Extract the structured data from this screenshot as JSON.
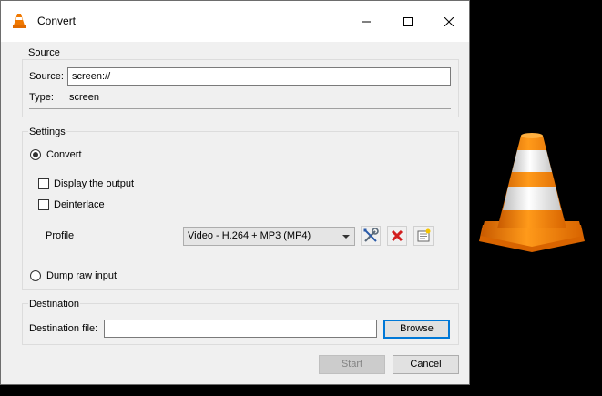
{
  "window": {
    "title": "Convert",
    "controls": {
      "minimize": "minimize",
      "maximize": "maximize",
      "close": "close"
    }
  },
  "source": {
    "group_title": "Source",
    "source_label": "Source:",
    "source_value": "screen://",
    "type_label": "Type:",
    "type_value": "screen"
  },
  "settings": {
    "group_title": "Settings",
    "convert_label": "Convert",
    "display_output_label": "Display the output",
    "deinterlace_label": "Deinterlace",
    "profile_label": "Profile",
    "profile_selected": "Video - H.264 + MP3 (MP4)",
    "dump_raw_label": "Dump raw input",
    "convert_checked": true,
    "dump_raw_checked": false,
    "display_output_checked": false,
    "deinterlace_checked": false
  },
  "destination": {
    "group_title": "Destination",
    "file_label": "Destination file:",
    "file_value": "",
    "browse_label": "Browse"
  },
  "footer": {
    "start_label": "Start",
    "cancel_label": "Cancel"
  },
  "icons": {
    "app": "vlc-cone-icon",
    "edit_profile": "wrench-screwdriver-icon",
    "delete_profile": "red-x-icon",
    "new_profile": "new-document-icon"
  },
  "colors": {
    "cone_orange": "#f07800",
    "default_button_border": "#0078d7"
  }
}
